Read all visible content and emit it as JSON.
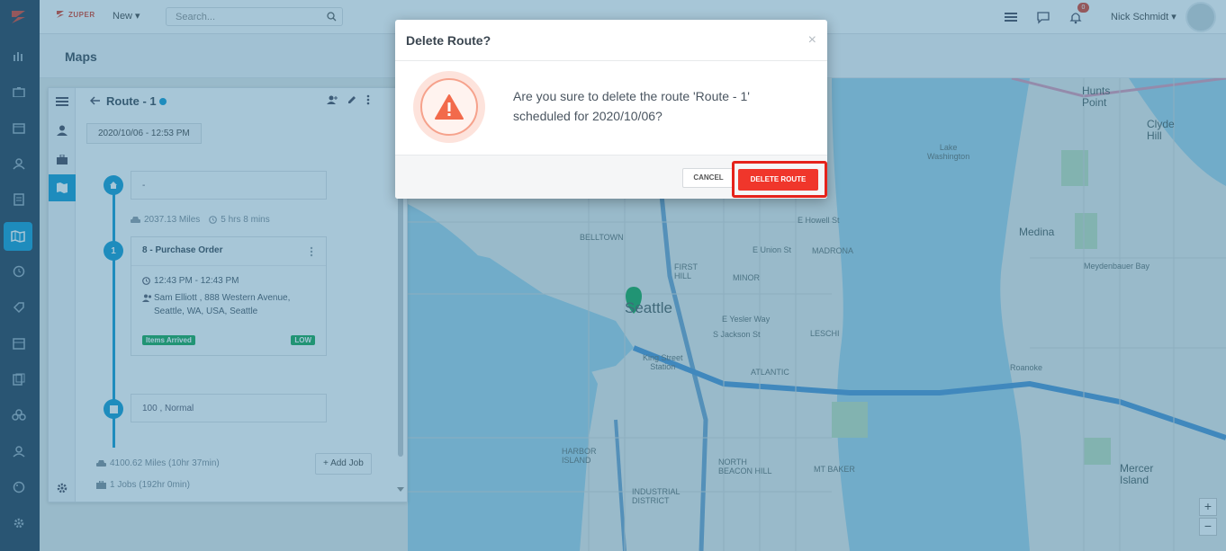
{
  "header": {
    "brand": "ZUPER",
    "new_label": "New ▾",
    "search_placeholder": "Search...",
    "notification_count": "0",
    "user_name": "Nick Schmidt ▾"
  },
  "page": {
    "title": "Maps"
  },
  "route_panel": {
    "title": "Route - 1",
    "date": "2020/10/06 - 12:53 PM",
    "start_stop": "-",
    "leg_distance": "2037.13 Miles",
    "leg_time": "5 hrs 8 mins",
    "job": {
      "number": "1",
      "title": "8 - Purchase Order",
      "time": "12:43 PM - 12:43 PM",
      "address_line1": "Sam Elliott , 888 Western Avenue,",
      "address_line2": "Seattle, WA, USA, Seattle",
      "status": "Items Arrived",
      "priority": "LOW"
    },
    "end_stop": "100 , Normal",
    "total_distance": "4100.62 Miles (10hr 37min)",
    "total_jobs": "1 Jobs (192hr 0min)",
    "add_job_label": "+ Add Job"
  },
  "map_labels": {
    "seattle": "Seattle",
    "medina": "Medina",
    "mercer_island": "Mercer\nIsland",
    "hunts_point": "Hunts\nPoint",
    "clyde_hill": "Clyde\nHill",
    "lake_washington": "Lake\nWashington",
    "belltown": "BELLTOWN",
    "first_hill": "FIRST\nHILL",
    "madrona": "MADRONA",
    "minor": "MINOR",
    "atlantic": "ATLANTIC",
    "leschi": "LESCHI",
    "harbor_island": "HARBOR\nISLAND",
    "industrial_district": "INDUSTRIAL\nDISTRICT",
    "north_beacon_hill": "NORTH\nBEACON HILL",
    "mt_baker": "MT BAKER",
    "king_street": "King Street\nStation",
    "meydenbauer": "Meydenbauer Bay",
    "union_st": "E Union St",
    "howell_st": "E Howell St",
    "yesler": "E Yesler Way",
    "jackson": "S Jackson St",
    "roanoke": "Roanoke"
  },
  "modal": {
    "title": "Delete Route?",
    "close": "×",
    "message": "Are you sure to delete the route 'Route - 1' scheduled for 2020/10/06?",
    "cancel_label": "CANCEL",
    "delete_label": "DELETE ROUTE"
  },
  "map_controls": {
    "zoom_in": "+",
    "zoom_out": "−"
  },
  "colors": {
    "accent": "#23a2d6",
    "danger": "#f0362b",
    "rail": "#34495e",
    "water": "#a8d5e8"
  }
}
